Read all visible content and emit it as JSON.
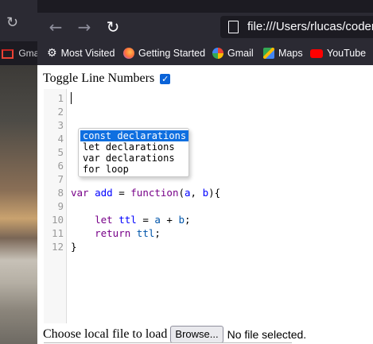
{
  "background_window": {
    "bookmark_partial": "Gmai",
    "icons": [
      "reload-icon",
      "gmail-icon"
    ]
  },
  "browser": {
    "back_icon": "←",
    "forward_icon": "→",
    "reload_icon": "↻",
    "url": "file:///Users/rlucas/codem"
  },
  "bookmarks": [
    {
      "label": "Most Visited",
      "icon": "gear-icon",
      "color": "#fbfbfe"
    },
    {
      "label": "Getting Started",
      "icon": "firefox-icon",
      "color": "#ff7139"
    },
    {
      "label": "Gmail",
      "icon": "google-icon",
      "color": "#4285f4"
    },
    {
      "label": "Maps",
      "icon": "maps-icon",
      "color": "#34a853"
    },
    {
      "label": "YouTube",
      "icon": "youtube-icon",
      "color": "#ff0000"
    }
  ],
  "page": {
    "toggle_label": "Toggle Line Numbers",
    "toggle_checked": true,
    "check_glyph": "✓",
    "line_numbers": [
      "1",
      "2",
      "3",
      "4",
      "5",
      "6",
      "7",
      "8",
      "9",
      "10",
      "11",
      "12"
    ],
    "code": {
      "line8": {
        "kw1": "var",
        "def": "add",
        "op": " = ",
        "kw2": "function",
        "args_open": "(",
        "a": "a",
        "comma": ", ",
        "b": "b",
        "close": "){"
      },
      "line10": {
        "indent": "    ",
        "kw": "let",
        "def": "ttl",
        "rest1": " = ",
        "a": "a",
        "plus": " + ",
        "b": "b",
        "semi": ";"
      },
      "line11": {
        "indent": "    ",
        "kw": "return",
        "var": "ttl",
        "semi": ";"
      },
      "line12": "}"
    },
    "autocomplete": [
      "const declarations",
      "let declarations",
      "var declarations",
      "for loop"
    ],
    "autocomplete_selected": "const declarations",
    "file_label": "Choose local file to load",
    "browse_label": "Browse...",
    "file_status": "No file selected."
  }
}
